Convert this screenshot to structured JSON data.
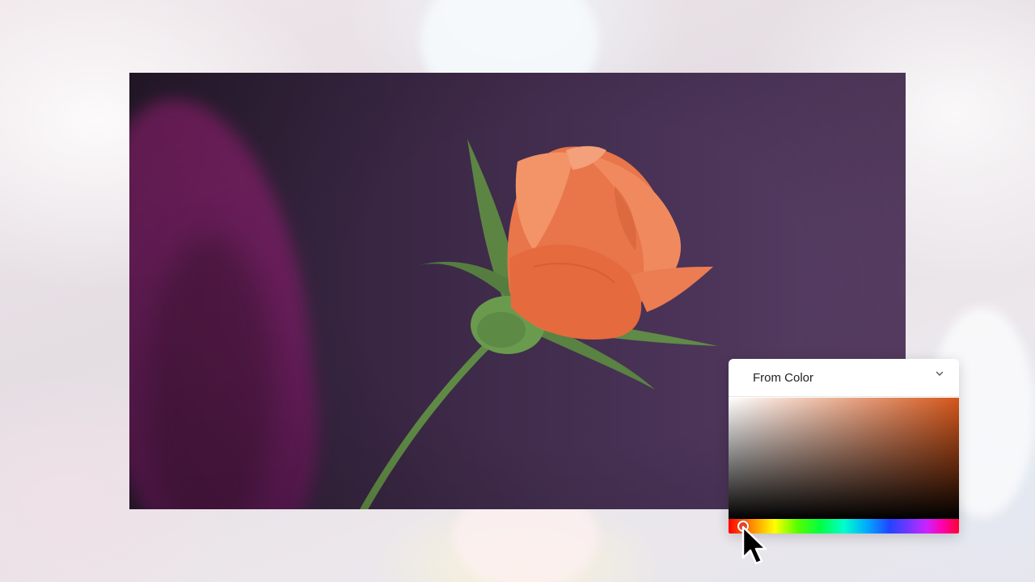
{
  "picker": {
    "title": "From Color",
    "chevron_icon": "chevron-down-icon",
    "gradient_end_color": "#d4561b",
    "hue_handle_color": "#e0442a",
    "hue_value_fraction": 0.04
  },
  "photo": {
    "subject": "orange-rose-bud"
  },
  "cursor": {
    "icon": "arrow-cursor-icon"
  }
}
